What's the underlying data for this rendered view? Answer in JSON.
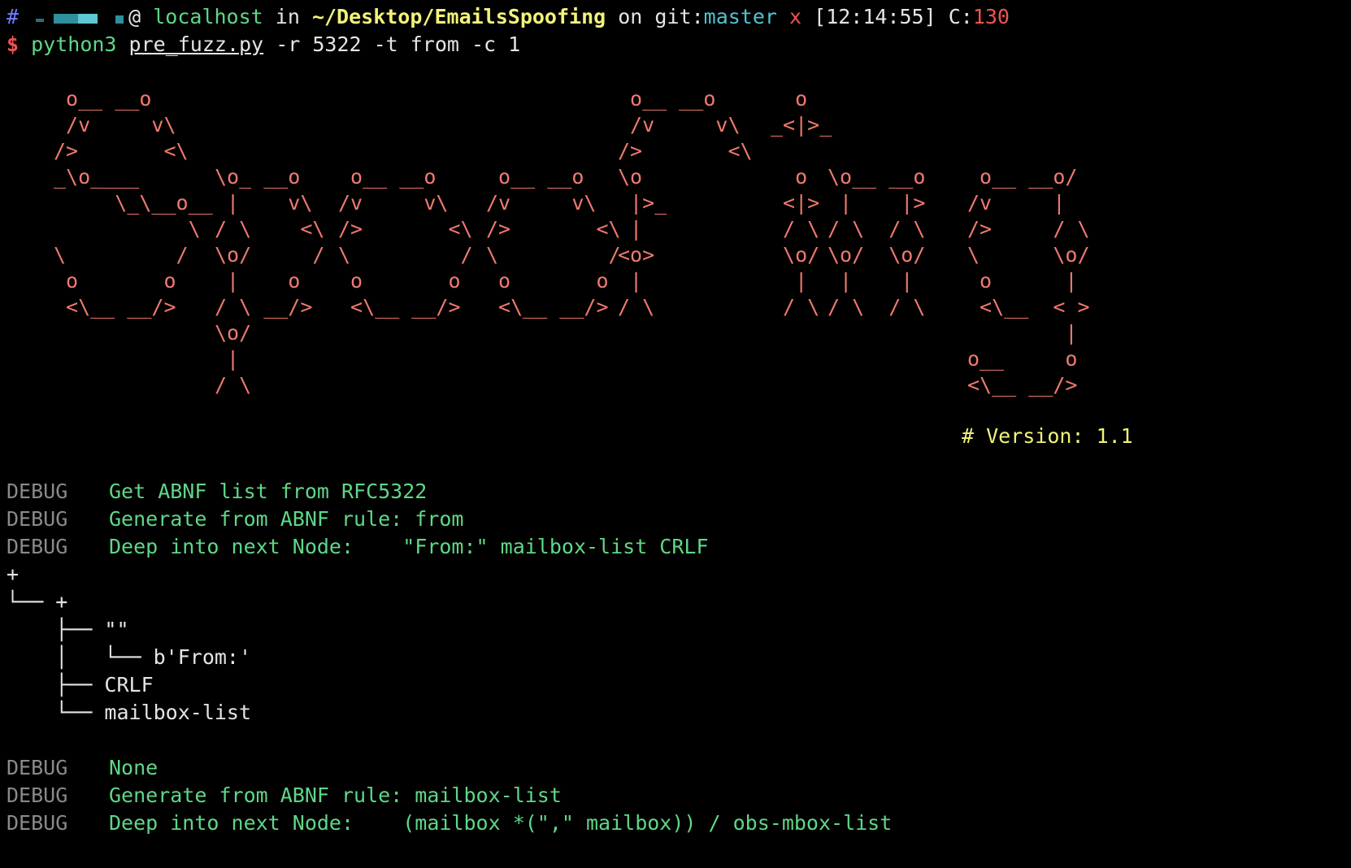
{
  "prompt": {
    "hash": "#",
    "at": "@",
    "host": "localhost",
    "in_word": "in",
    "path": "~/Desktop/EmailsSpoofing",
    "on_word": "on",
    "git_label": "git:",
    "branch": "master",
    "dirty_mark": "x",
    "time": "[12:14:55]",
    "code_label": "C:",
    "code": "130"
  },
  "command": {
    "dollar": "$",
    "bin": "python3",
    "file": "pre_fuzz.py",
    "args": "-r 5322 -t from -c 1"
  },
  "banner": {
    "left": " o__ __o\n /v     v\\\n/>       <\\\n_\\o____\n     \\_\\__o__\n           \\\n\\         /\n o       o\n <\\__ __/>",
    "p": "\\o_ __o\n |    v\\\n/ \\    <\\\n\\o/     /\n |    o\n/ \\ __/>\n\\o/\n |\n/ \\",
    "o1": " o__ __o\n/v     v\\\n/>       <\\\n\\         /\n o       o\n <\\__ __/>",
    "o2": " o__ __o\n/v     v\\\n/>       <\\\n\\         /\n o       o\n <\\__ __/>",
    "f": " o__ __o\n /v     v\\\n/>       <\\\n\\o\n |>_\n |\n<o>\n |\n/ \\",
    "i": "  o\n_<|>_\n\n  o\n <|>\n / \\\n \\o/\n  |\n / \\",
    "n_r": "\\o__ __o\n |    |>\n/ \\  / \\\n\\o/  \\o/\n |    |\n/ \\  / \\",
    "g": " o__ __o/\n/v     |\n/>     / \\\n\\      \\o/\n o      |\n <\\__  < >\n        |\no__     o\n<\\__ __/>",
    "version": "# Version: 1.1"
  },
  "log_top": [
    {
      "level": "DEBUG",
      "msg": "Get ABNF list from RFC5322"
    },
    {
      "level": "DEBUG",
      "msg": "Generate from ABNF rule: from"
    },
    {
      "level": "DEBUG",
      "msg": "Deep into next Node:    \"From:\" mailbox-list CRLF"
    }
  ],
  "tree": [
    "+",
    "└── +",
    "    ├── \"\"",
    "    │   └── b'From:'",
    "    ├── CRLF",
    "    └── mailbox-list"
  ],
  "log_bottom": [
    {
      "level": "DEBUG",
      "msg": "None"
    },
    {
      "level": "DEBUG",
      "msg": "Generate from ABNF rule: mailbox-list"
    },
    {
      "level": "DEBUG",
      "msg": "Deep into next Node:    (mailbox *(\",\" mailbox)) / obs-mbox-list"
    }
  ]
}
